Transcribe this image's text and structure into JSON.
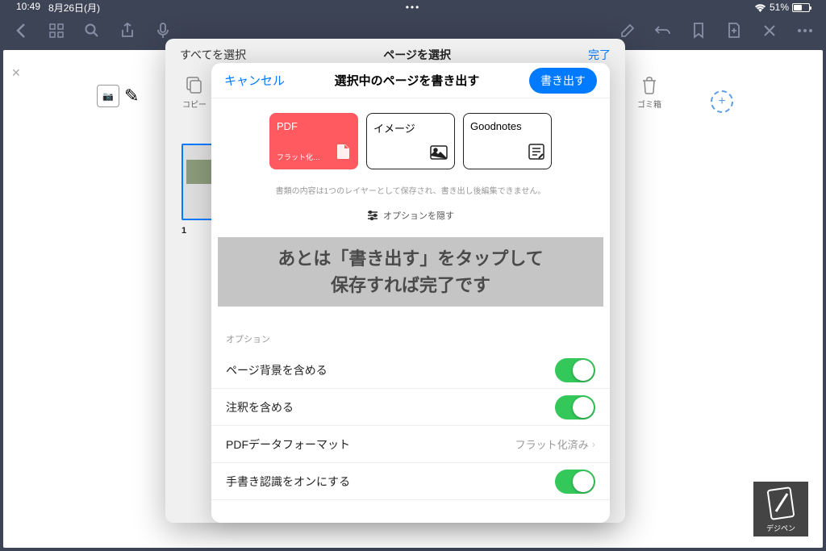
{
  "status": {
    "time": "10:49",
    "date": "8月26日(月)",
    "battery": "51%",
    "center_dots": "•••"
  },
  "sheet": {
    "select_all": "すべてを選択",
    "title": "ページを選択",
    "done": "完了"
  },
  "page_number": "1",
  "bg_actions": {
    "copy": "コピー",
    "trash": "ゴミ箱"
  },
  "modal": {
    "cancel": "キャンセル",
    "title": "選択中のページを書き出す",
    "export": "書き出す",
    "formats": [
      {
        "title": "PDF",
        "sub": "フラット化…",
        "icon": "pdf",
        "selected": true
      },
      {
        "title": "イメージ",
        "sub": "",
        "icon": "image",
        "selected": false
      },
      {
        "title": "Goodnotes",
        "sub": "",
        "icon": "note",
        "selected": false
      }
    ],
    "hint": "書類の内容は1つのレイヤーとして保存され、書き出し後編集できません。",
    "options_toggle": "オプションを隠す",
    "options_header": "オプション",
    "options": [
      {
        "label": "ページ背景を含める",
        "type": "toggle",
        "on": true
      },
      {
        "label": "注釈を含める",
        "type": "toggle",
        "on": true
      },
      {
        "label": "PDFデータフォーマット",
        "type": "value",
        "value": "フラット化済み"
      },
      {
        "label": "手書き認識をオンにする",
        "type": "toggle",
        "on": true
      }
    ]
  },
  "annotation": {
    "line1": "あとは「書き出す」をタップして",
    "line2": "保存すれば完了です"
  },
  "logo": "デジペン"
}
